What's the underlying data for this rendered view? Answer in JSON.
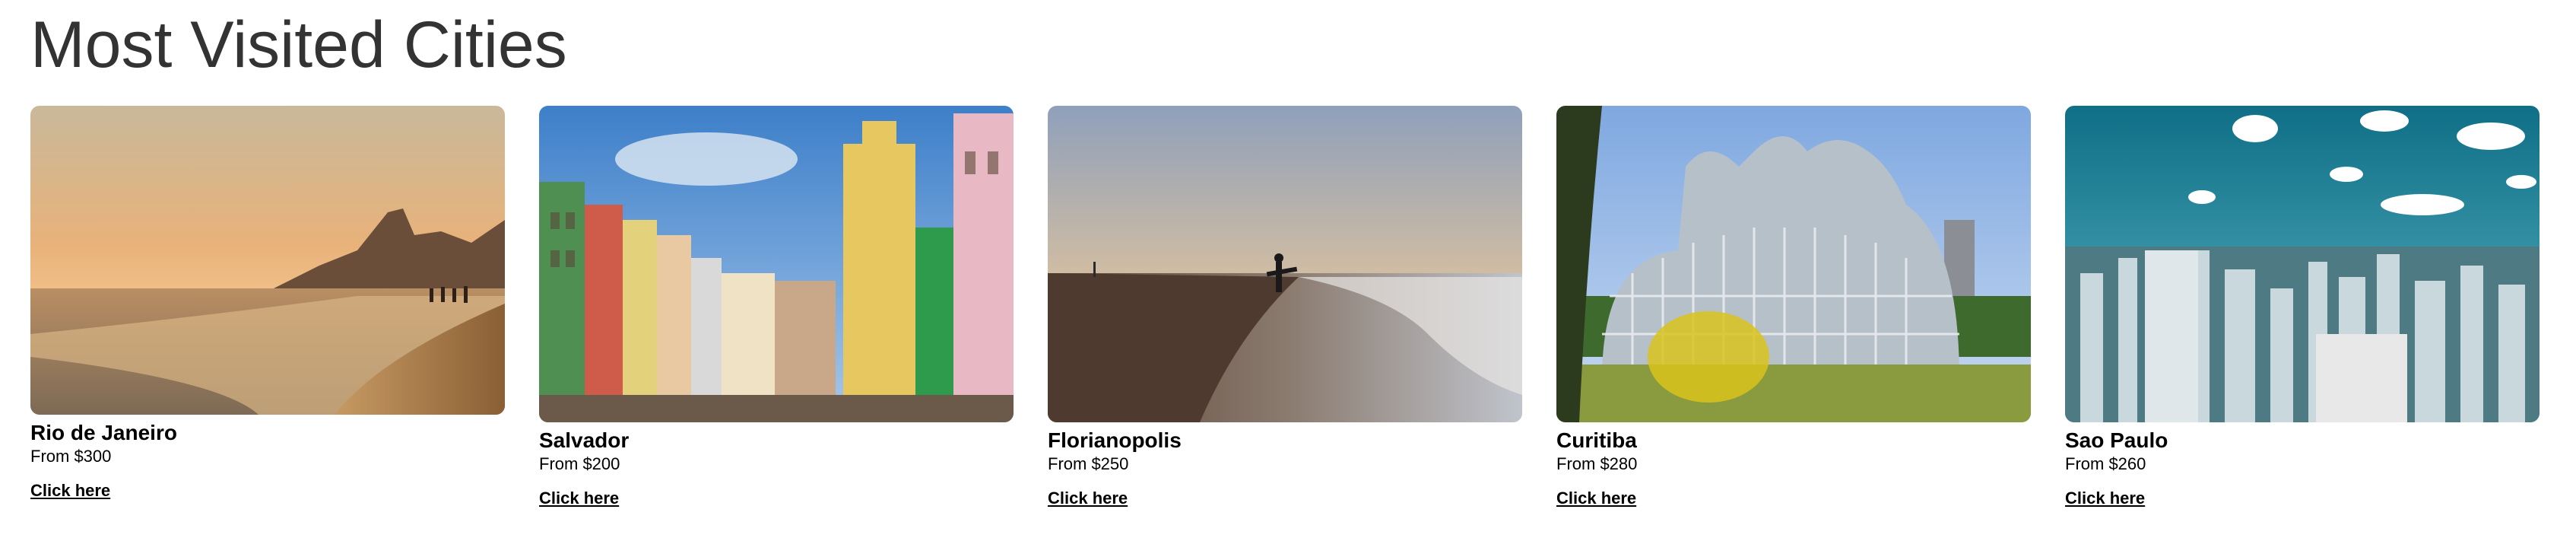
{
  "page": {
    "title": "Most Visited Cities"
  },
  "cities": [
    {
      "name": "Rio de Janeiro",
      "price": "From $300",
      "link": "Click here"
    },
    {
      "name": "Salvador",
      "price": "From $200",
      "link": "Click here"
    },
    {
      "name": "Florianopolis",
      "price": "From $250",
      "link": "Click here"
    },
    {
      "name": "Curitiba",
      "price": "From $280",
      "link": "Click here"
    },
    {
      "name": "Sao Paulo",
      "price": "From $260",
      "link": "Click here"
    }
  ]
}
